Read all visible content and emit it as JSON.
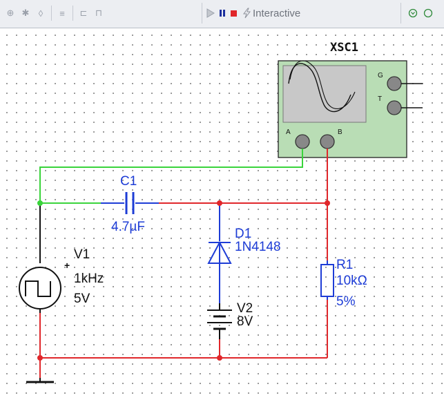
{
  "toolbar": {
    "left_icons": [
      "grapher-icon",
      "probe-icon",
      "bulb-icon",
      "component-icon",
      "net-icon",
      "pulse-icon"
    ],
    "run_icon": "play-icon",
    "pause_icon": "pause-icon",
    "stop_icon": "stop-icon",
    "interactive_label": "Interactive",
    "right_icons": [
      "zoom-icon",
      "globe-icon"
    ]
  },
  "oscilloscope": {
    "ref": "XSC1",
    "terminals": [
      "G",
      "T",
      "A",
      "B"
    ]
  },
  "components": {
    "c1": {
      "ref": "C1",
      "value": "4.7µF"
    },
    "d1": {
      "ref": "D1",
      "value": "1N4148"
    },
    "v1": {
      "ref": "V1",
      "freq": "1kHz",
      "ampl": "5V",
      "plus": "+"
    },
    "v2": {
      "ref": "V2",
      "value": "8V"
    },
    "r1": {
      "ref": "R1",
      "value": "10kΩ",
      "tol": "5%"
    }
  },
  "colors": {
    "wire_red": "#e0262a",
    "wire_green": "#39d43b",
    "wire_blue": "#1d3cd6",
    "scope_body": "#b9ddb5",
    "scope_screen": "#c8c8c8"
  }
}
